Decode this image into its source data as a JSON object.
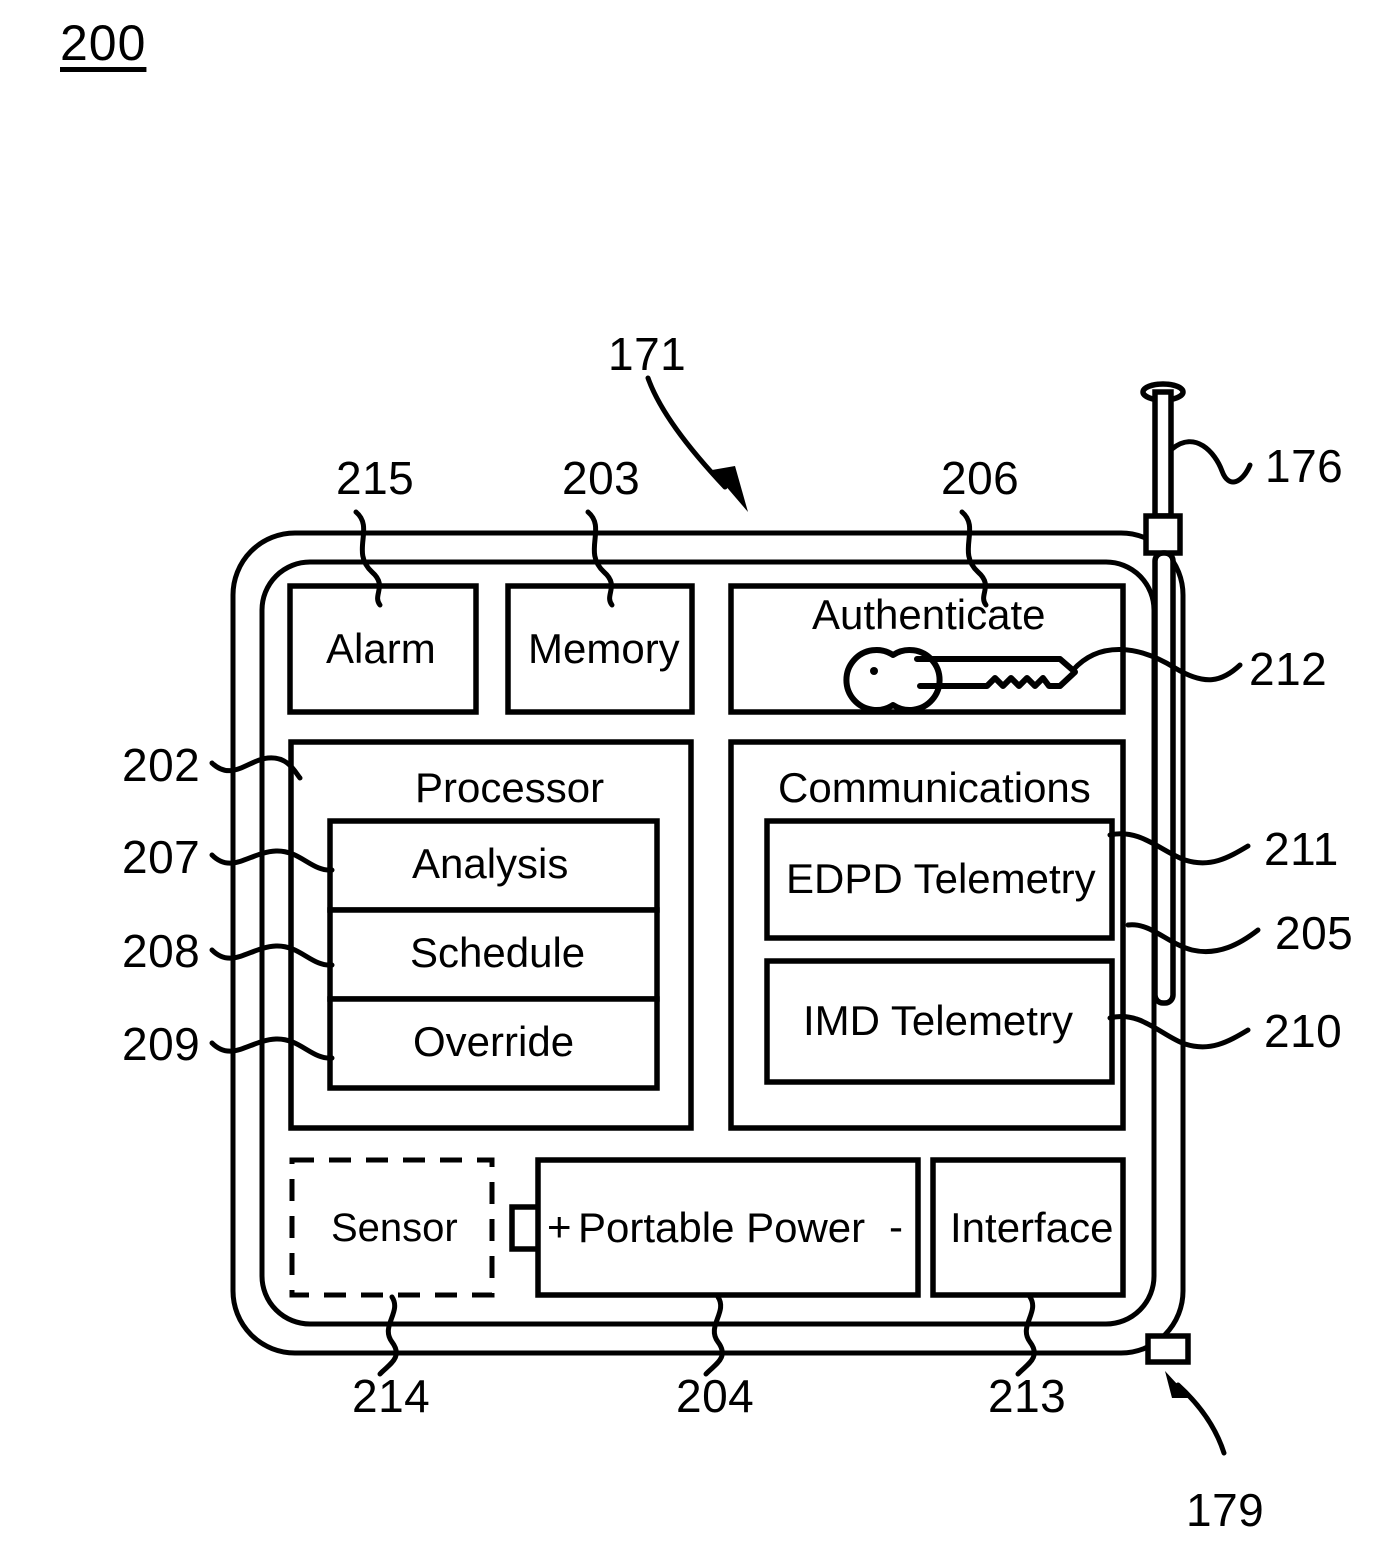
{
  "figure": {
    "number": "200",
    "device_ref": "171"
  },
  "reference_numerals": {
    "figure_label": "200",
    "device": "171",
    "antenna_external": "176",
    "alarm": "215",
    "memory": "203",
    "authenticate": "206",
    "key_icon": "212",
    "housing": "202",
    "analysis": "207",
    "schedule": "208",
    "override": "209",
    "edpd_telemetry": "211",
    "internal_antenna": "205",
    "imd_telemetry": "210",
    "sensor": "214",
    "portable_power": "204",
    "interface": "213",
    "connector_port": "179"
  },
  "blocks": {
    "alarm": {
      "label": "Alarm",
      "ref": "215"
    },
    "memory": {
      "label": "Memory",
      "ref": "203"
    },
    "authenticate": {
      "label": "Authenticate",
      "ref": "206",
      "icon": "key-icon",
      "icon_ref": "212"
    },
    "processor": {
      "label": "Processor",
      "sub_blocks": [
        {
          "label": "Analysis",
          "ref": "207"
        },
        {
          "label": "Schedule",
          "ref": "208"
        },
        {
          "label": "Override",
          "ref": "209"
        }
      ]
    },
    "communications": {
      "label": "Communications",
      "sub_blocks": [
        {
          "label": "EDPD Telemetry",
          "ref": "211"
        },
        {
          "label": "IMD Telemetry",
          "ref": "210"
        }
      ]
    },
    "sensor": {
      "label": "Sensor",
      "ref": "214",
      "style": "dashed"
    },
    "portable_power": {
      "label": "Portable Power",
      "ref": "204",
      "positive_terminal": "+",
      "negative_terminal": "-"
    },
    "interface": {
      "label": "Interface",
      "ref": "213"
    }
  },
  "hardware": {
    "external_antenna": {
      "ref": "176",
      "name": "antenna-icon"
    },
    "internal_antenna": {
      "ref": "205",
      "name": "internal-antenna-element"
    },
    "connector": {
      "ref": "179",
      "name": "connector-port"
    },
    "housing": {
      "ref": "202",
      "name": "device-housing-shell"
    }
  },
  "colors": {
    "ink": "#000000",
    "paper": "#ffffff"
  }
}
